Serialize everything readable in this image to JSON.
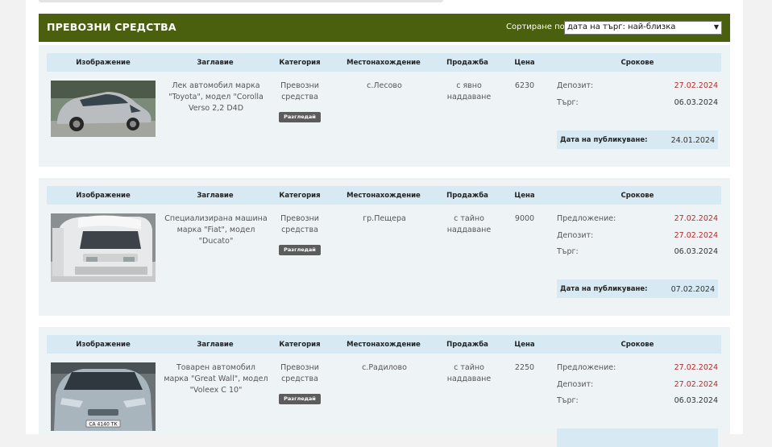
{
  "header": {
    "title": "ПРЕВОЗНИ СРЕДСТВА",
    "sort_label": "Сортиране по",
    "sort_value": "дата на търг: най-близка"
  },
  "columns": {
    "image": "Изображение",
    "title": "Заглавие",
    "category": "Категория",
    "location": "Местонахождение",
    "sale": "Продажба",
    "price": "Цена",
    "terms": "Срокове"
  },
  "listings": [
    {
      "title": "Лек автомобил марка \"Toyota\", модел \"Corolla Verso 2,2 D4D",
      "category": "Превозни средства",
      "view_button": "Разгледай",
      "location": "с.Лесово",
      "sale": "с явно наддаване",
      "price": "6230",
      "terms": [
        {
          "label": "Депозит:",
          "value": "27.02.2024",
          "color": "red"
        },
        {
          "label": "Търг:",
          "value": "06.03.2024",
          "color": "dark"
        }
      ],
      "published_label": "Дата на публикуване:",
      "published_value": "24.01.2024",
      "thumb_icon": "silver-minivan-photo"
    },
    {
      "title": "Специализирана машина марка \"Fiat\", модел \"Ducato\"",
      "category": "Превозни средства",
      "view_button": "Разгледай",
      "location": "гр.Пещера",
      "sale": "с тайно наддаване",
      "price": "9000",
      "terms": [
        {
          "label": "Предложение:",
          "value": "27.02.2024",
          "color": "red"
        },
        {
          "label": "Депозит:",
          "value": "27.02.2024",
          "color": "red"
        },
        {
          "label": "Търг:",
          "value": "06.03.2024",
          "color": "dark"
        }
      ],
      "published_label": "Дата на публикуване:",
      "published_value": "07.02.2024",
      "thumb_icon": "white-van-photo"
    },
    {
      "title": "Товарен автомобил марка \"Great Wall\", модел \"Voleex C 10\"",
      "category": "Превозни средства",
      "view_button": "Разгледай",
      "location": "с.Радилово",
      "sale": "с тайно наддаване",
      "price": "2250",
      "terms": [
        {
          "label": "Предложение:",
          "value": "27.02.2024",
          "color": "red"
        },
        {
          "label": "Депозит:",
          "value": "27.02.2024",
          "color": "red"
        },
        {
          "label": "Търг:",
          "value": "06.03.2024",
          "color": "dark"
        }
      ],
      "plate_text": "СА 4140 ТК",
      "thumb_icon": "silver-hatchback-photo"
    }
  ],
  "colors": {
    "header_bg": "#4b600f",
    "card_bg": "#eef4f6",
    "table_head_bg": "#d7eaf3",
    "date_red": "#b52b2b",
    "button_bg": "#5c5c5c"
  }
}
